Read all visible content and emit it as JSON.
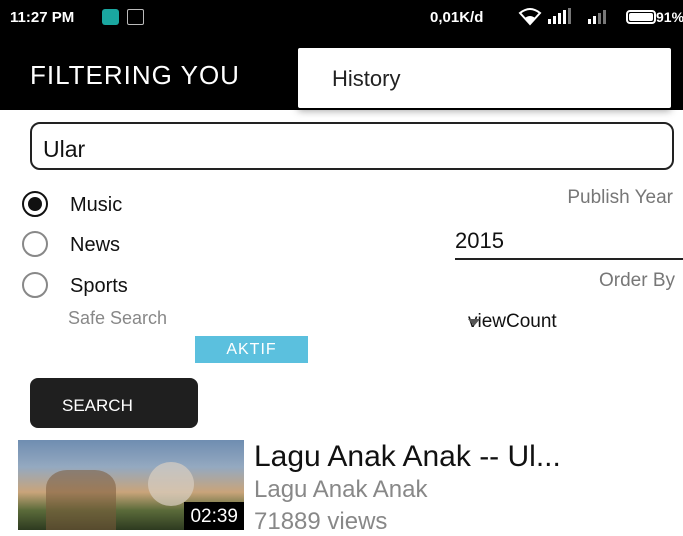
{
  "status_bar": {
    "time": "11:27 PM",
    "network_speed": "0,01K/d",
    "battery": "91%",
    "icons": [
      "notification-app-icon",
      "message-icon",
      "wifi-icon",
      "signal-icon",
      "signal-icon",
      "battery-icon"
    ]
  },
  "app_bar": {
    "title": "FILTERING YOU"
  },
  "overflow_menu": {
    "items": [
      {
        "label": "History"
      }
    ]
  },
  "search": {
    "value": "Ular"
  },
  "categories": [
    {
      "label": "Music",
      "checked": true
    },
    {
      "label": "News",
      "checked": false
    },
    {
      "label": "Sports",
      "checked": false
    }
  ],
  "filters": {
    "publish_year_label": "Publish Year",
    "publish_year_value": "2015",
    "order_by_label": "Order By",
    "order_by_value": "viewCount",
    "safe_search_label": "Safe Search",
    "safe_search_state": "AKTIF"
  },
  "search_button": {
    "label": "SEARCH"
  },
  "results": [
    {
      "title": "Lagu Anak Anak -- Ul...",
      "channel": "Lagu Anak Anak",
      "views": "71889 views",
      "duration": "02:39"
    }
  ],
  "colors": {
    "toolbar": "#000000",
    "toggle_on": "#5bc0de",
    "button_dark": "#1f1f1f"
  }
}
